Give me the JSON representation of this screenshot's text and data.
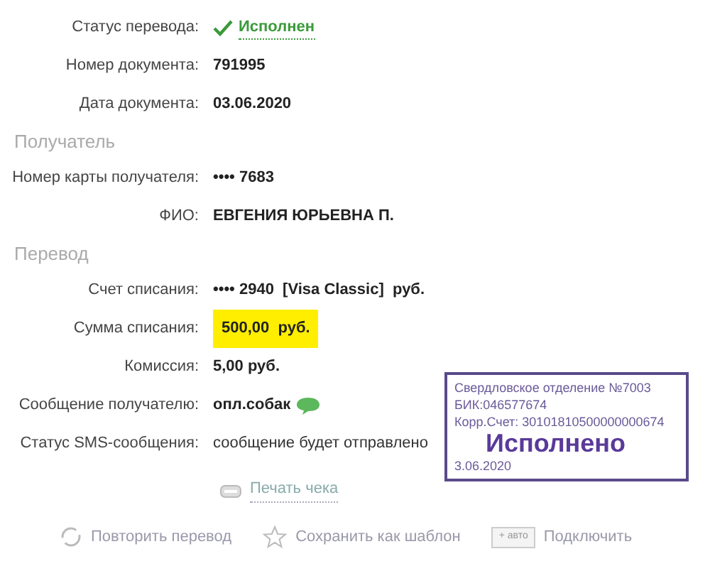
{
  "sections": [
    {
      "rows": [
        {
          "kind": "status",
          "label": "Статус перевода:",
          "value": "Исполнен"
        },
        {
          "kind": "text",
          "label": "Номер документа:",
          "value": "791995"
        },
        {
          "kind": "text",
          "label": "Дата документа:",
          "value": "03.06.2020"
        }
      ]
    },
    {
      "title": "Получатель",
      "rows": [
        {
          "kind": "text",
          "label": "Номер карты получателя:",
          "value": "•••• 7683"
        },
        {
          "kind": "text",
          "label": "ФИО:",
          "value": "ЕВГЕНИЯ ЮРЬЕВНА П."
        }
      ]
    },
    {
      "title": "Перевод",
      "rows": [
        {
          "kind": "text",
          "label": "Счет списания:",
          "value": "•••• 2940  [Visa Classic]  руб."
        },
        {
          "kind": "highlight",
          "label": "Сумма списания:",
          "value": "500,00  руб."
        },
        {
          "kind": "text",
          "label": "Комиссия:",
          "value": "5,00 руб."
        },
        {
          "kind": "sms",
          "label": "Сообщение получателю:",
          "value": "опл.собак"
        },
        {
          "kind": "plain",
          "label": "Статус SMS-сообщения:",
          "value": "сообщение будет отправлено"
        }
      ]
    }
  ],
  "stamp": {
    "lines": [
      "Свердловское отделение №7003",
      "БИК:046577674",
      "Корр.Счет: 30101810500000000674"
    ],
    "mark": "Исполнено",
    "date": "3.06.2020"
  },
  "print_link": "Печать чека",
  "actions": [
    {
      "kind": "repeat",
      "label": "Повторить перевод"
    },
    {
      "kind": "star",
      "label": "Сохранить как шаблон"
    },
    {
      "kind": "auto",
      "badge": "+ авто",
      "label": "Подключить"
    }
  ]
}
